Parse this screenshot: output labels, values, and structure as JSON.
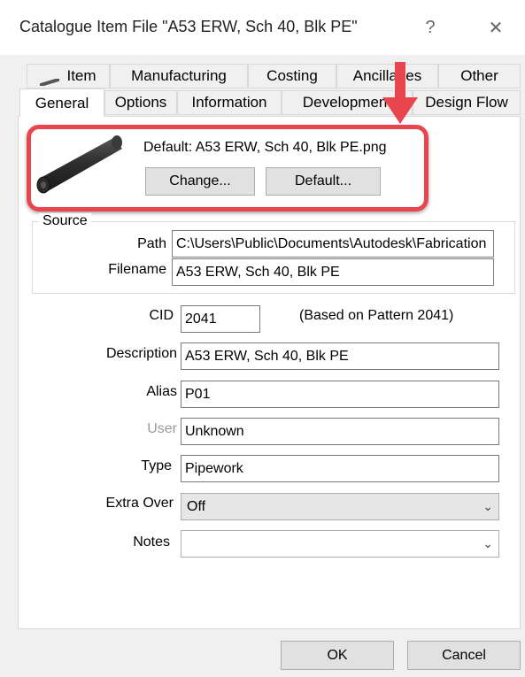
{
  "window": {
    "title": "Catalogue Item File \"A53 ERW, Sch 40, Blk PE\"",
    "help_label": "?",
    "close_label": "✕"
  },
  "tabs": {
    "row1": [
      "Item",
      "Manufacturing",
      "Costing",
      "Ancillaries",
      "Other"
    ],
    "row2": [
      "General",
      "Options",
      "Information",
      "Development",
      "Design Flow"
    ],
    "active": "General"
  },
  "image": {
    "default_label": "Default: A53 ERW, Sch 40, Blk PE.png",
    "change_button": "Change...",
    "default_button": "Default..."
  },
  "source": {
    "group_title": "Source",
    "path_label": "Path",
    "path_value": "C:\\Users\\Public\\Documents\\Autodesk\\Fabrication",
    "filename_label": "Filename",
    "filename_value": "A53 ERW, Sch 40, Blk PE"
  },
  "fields": {
    "cid_label": "CID",
    "cid_value": "2041",
    "cid_note": "(Based on Pattern 2041)",
    "description_label": "Description",
    "description_value": "A53 ERW, Sch 40, Blk PE",
    "alias_label": "Alias",
    "alias_value": "P01",
    "user_label": "User",
    "user_value": "Unknown",
    "type_label": "Type",
    "type_value": "Pipework",
    "extra_over_label": "Extra Over",
    "extra_over_value": "Off",
    "notes_label": "Notes",
    "notes_value": ""
  },
  "footer": {
    "ok_label": "OK",
    "cancel_label": "Cancel"
  },
  "colors": {
    "highlight": "#e8454f",
    "arrow": "#e8454f"
  }
}
